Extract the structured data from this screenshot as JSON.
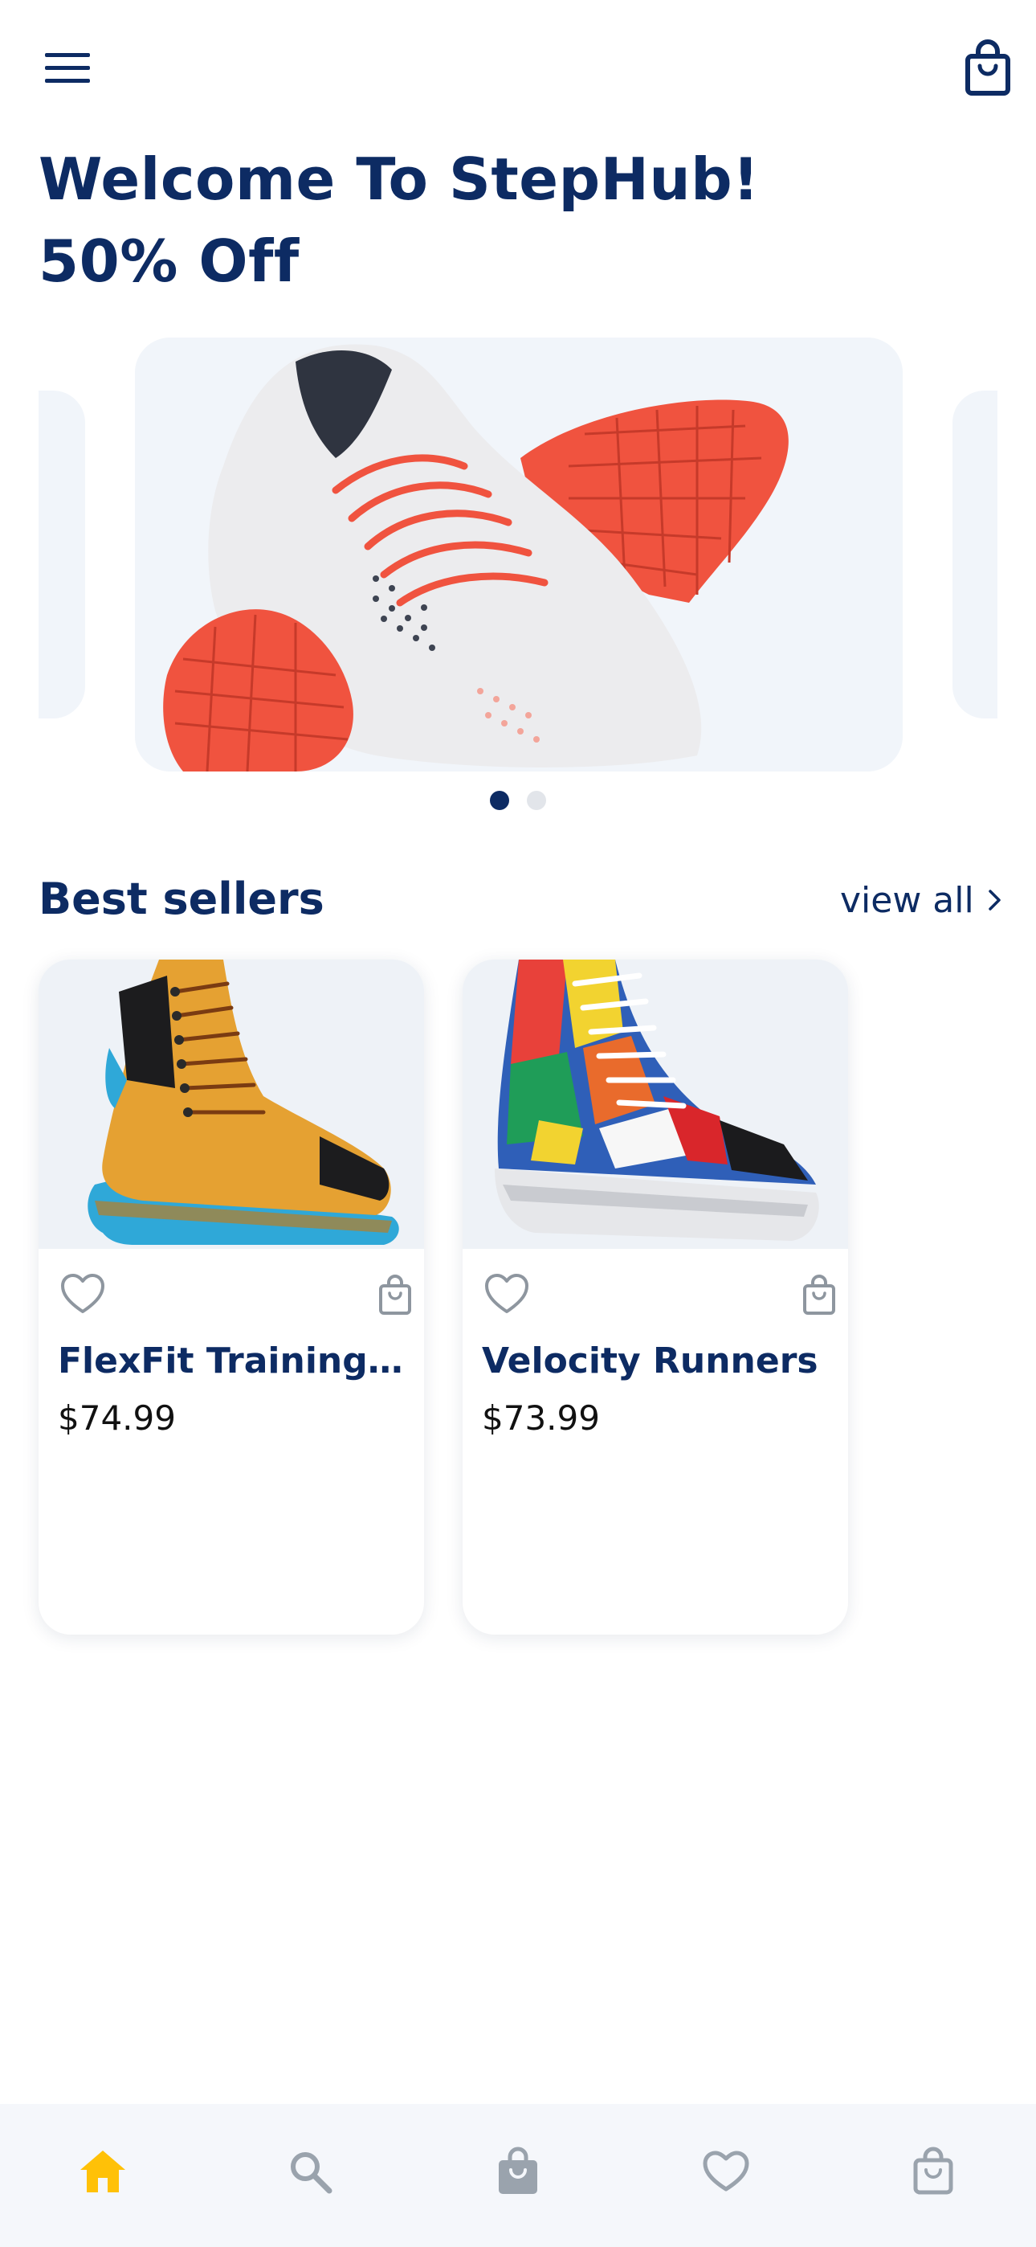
{
  "header": {
    "menu_icon": "hamburger-menu-icon",
    "cart_icon": "shopping-bag-icon",
    "headline_line1": "Welcome To StepHub!",
    "headline_line2": "50% Off"
  },
  "carousel": {
    "slide_count": 2,
    "active_index": 0,
    "slide_subject": "white and red running shoes"
  },
  "best_sellers": {
    "title": "Best sellers",
    "view_all_label": "view all",
    "view_all_icon": "chevron-right-icon",
    "products": [
      {
        "name": "FlexFit Training Sh…",
        "price": "$74.99",
        "image": "yellow hiking boot"
      },
      {
        "name": "Velocity Runners",
        "price": "$73.99",
        "image": "multicolor high-top sneaker"
      }
    ]
  },
  "bottom_nav": {
    "items": [
      {
        "icon": "home-icon",
        "active": true
      },
      {
        "icon": "search-icon",
        "active": false
      },
      {
        "icon": "shopping-bag-icon",
        "active": false
      },
      {
        "icon": "heart-icon",
        "active": false
      },
      {
        "icon": "cart-bag-outline-icon",
        "active": false
      }
    ]
  },
  "colors": {
    "primary": "#0d2b63",
    "accent": "#ffc107",
    "muted_icon": "#9aa3ad",
    "nav_background": "#f5f7fb",
    "slide_background": "#f1f5fa"
  }
}
